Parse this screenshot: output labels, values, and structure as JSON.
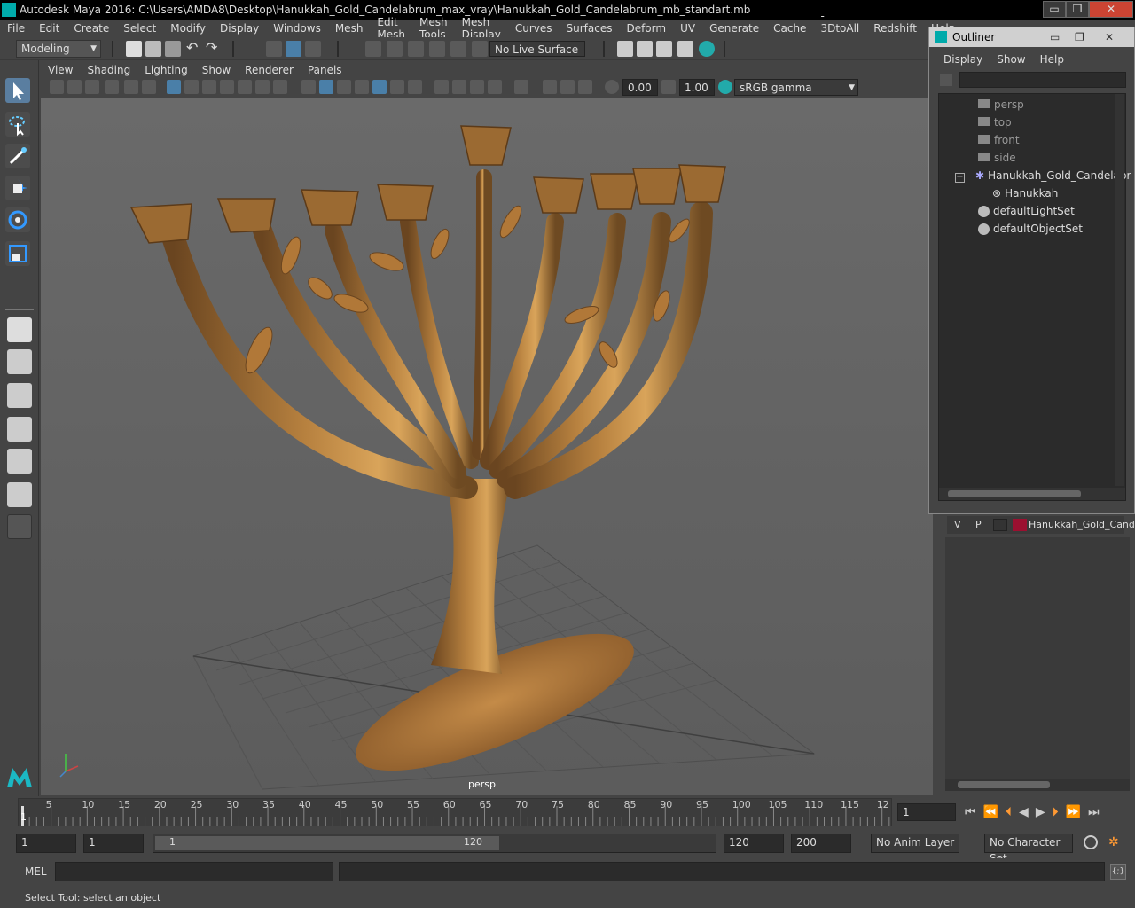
{
  "window": {
    "title": "Autodesk Maya 2016: C:\\Users\\AMDA8\\Desktop\\Hanukkah_Gold_Candelabrum_max_vray\\Hanukkah_Gold_Candelabrum_mb_standart.mb",
    "minimize": "▭",
    "restore": "❐",
    "close": "✕"
  },
  "menubar": [
    "File",
    "Edit",
    "Create",
    "Select",
    "Modify",
    "Display",
    "Windows",
    "Mesh",
    "Edit Mesh",
    "Mesh Tools",
    "Mesh Display",
    "Curves",
    "Surfaces",
    "Deform",
    "UV",
    "Generate",
    "Cache",
    "- 3DtoAll -",
    "Redshift",
    "Help"
  ],
  "shelf": {
    "mode": "Modeling",
    "live_surface": "No Live Surface"
  },
  "viewport": {
    "menu": [
      "View",
      "Shading",
      "Lighting",
      "Show",
      "Renderer",
      "Panels"
    ],
    "exposure": "0.00",
    "gamma": "1.00",
    "color_space": "sRGB gamma",
    "camera_label": "persp"
  },
  "outliner": {
    "title": "Outliner",
    "menu": [
      "Display",
      "Show",
      "Help"
    ],
    "items": [
      {
        "label": "persp",
        "type": "camera"
      },
      {
        "label": "top",
        "type": "camera"
      },
      {
        "label": "front",
        "type": "camera"
      },
      {
        "label": "side",
        "type": "camera"
      },
      {
        "label": "Hanukkah_Gold_Candelabr",
        "type": "group"
      },
      {
        "label": "Hanukkah",
        "type": "mesh"
      },
      {
        "label": "defaultLightSet",
        "type": "set"
      },
      {
        "label": "defaultObjectSet",
        "type": "set"
      }
    ]
  },
  "layers": {
    "v": "V",
    "p": "P",
    "layer_name": "Hanukkah_Gold_Cand",
    "layer_color": "#9b1030"
  },
  "timeline": {
    "ticks": [
      "5",
      "10",
      "15",
      "20",
      "25",
      "30",
      "35",
      "40",
      "45",
      "50",
      "55",
      "60",
      "65",
      "70",
      "75",
      "80",
      "85",
      "90",
      "95",
      "100",
      "105",
      "110",
      "115",
      "12"
    ],
    "start_mark": "1",
    "current_frame": "1"
  },
  "range": {
    "start": "1",
    "playback_start": "1",
    "slider_start": "1",
    "slider_end": "120",
    "playback_end": "120",
    "end": "200",
    "anim_layer": "No Anim Layer",
    "character_set": "No Character Set"
  },
  "cmdline": {
    "label": "MEL"
  },
  "help": {
    "text": "Select Tool: select an object"
  }
}
